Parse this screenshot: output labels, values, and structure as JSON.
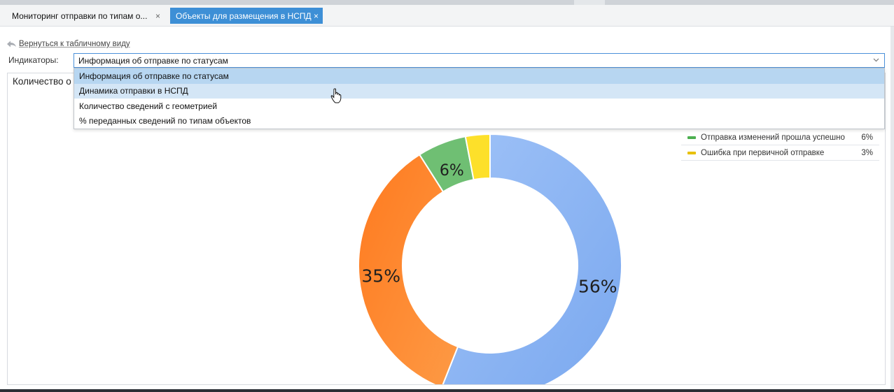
{
  "tabs": [
    {
      "label": "Мониторинг отправки по типам о...",
      "close": "×",
      "active": false
    },
    {
      "label": "Объекты для размещения в НСПД",
      "close": "×",
      "active": true
    }
  ],
  "back_link": {
    "label": "Вернуться к табличному виду",
    "icon": "back-arrow-icon"
  },
  "indicators": {
    "label": "Индикаторы:",
    "selected": "Информация об отправке по статусам",
    "options": [
      "Информация об отправке по статусам",
      "Динамика отправки в НСПД",
      "Количество сведений с геометрией",
      "% переданных сведений по типам объектов"
    ],
    "selected_index": 0,
    "hover_index": 1
  },
  "panel": {
    "title": "Количество о"
  },
  "chart_data": {
    "type": "pie",
    "categories": [
      "",
      "",
      "Отправка изменений прошла успешно",
      "Ошибка при первичной отправке"
    ],
    "values": [
      56,
      35,
      6,
      3
    ],
    "data_labels": [
      "56%",
      "35%",
      "6%",
      ""
    ],
    "colors": [
      "#8ab4f2",
      "#fd8a32",
      "#6fbf73",
      "#fde02a"
    ]
  },
  "legend": [
    {
      "label": "Отправка изменений прошла успешно",
      "value": "6%",
      "color": "#4caf50"
    },
    {
      "label": "Ошибка при первичной отправке",
      "value": "3%",
      "color": "#e8c000"
    }
  ],
  "colors": {
    "accent": "#3d8fd6",
    "select_border": "#4a90d9",
    "selected_bg": "#b7d6f1",
    "hover_bg": "#d4e6f6"
  }
}
